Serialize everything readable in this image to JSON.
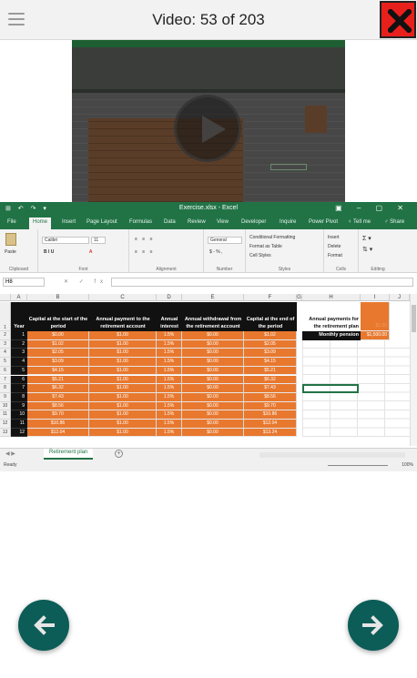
{
  "header": {
    "title": "Video: 53 of 203",
    "close_icon": "close-x-icon",
    "menu_icon": "hamburger-menu-icon",
    "accent": "#e8201c"
  },
  "video": {
    "play_icon": "play-icon"
  },
  "excel": {
    "window_title": "Exercise.xlsx - Excel",
    "quick_access": "⊞ ↶ ↷ ▾",
    "window_controls": "▣ – ▢ ✕",
    "ribbon_tabs": [
      "File",
      "Home",
      "Insert",
      "Page Layout",
      "Formulas",
      "Data",
      "Review",
      "View",
      "Developer",
      "Inquire",
      "Power Pivot",
      "♀ Tell me",
      "♂ Share"
    ],
    "active_tab": "Home",
    "ribbon": {
      "clipboard_label": "Clipboard",
      "paste_label": "Paste",
      "font_label": "Font",
      "font_name": "Calibri",
      "font_size": "11",
      "alignment_label": "Alignment",
      "number_label": "Number",
      "number_format": "General",
      "number_symbols": "$ - % ,",
      "styles_label": "Styles",
      "conditional_formatting": "Conditional Formatting",
      "format_as_table": "Format as Table",
      "cell_styles": "Cell Styles",
      "cells_label": "Cells",
      "insert": "Insert",
      "delete": "Delete",
      "format": "Format",
      "editing_label": "Editing"
    },
    "name_box": "H8",
    "fx": "fx",
    "columns": [
      "A",
      "B",
      "C",
      "D",
      "E",
      "F",
      "G",
      "H",
      "I",
      "J"
    ],
    "table_headers": {
      "year": "Year",
      "b": "Capital at the start of the period",
      "c": "Annual payment to the retirement account",
      "d": "Annual interest",
      "e": "Annual withdrawal from the retirement account",
      "f": "Capital at the end of the period"
    },
    "rows": [
      [
        "1",
        "$0.00",
        "$1.00",
        "1.5%",
        "$0.00",
        "$1.02"
      ],
      [
        "2",
        "$1.02",
        "$1.00",
        "1.5%",
        "$0.00",
        "$2.05"
      ],
      [
        "3",
        "$2.05",
        "$1.00",
        "1.5%",
        "$0.00",
        "$3.09"
      ],
      [
        "4",
        "$3.09",
        "$1.00",
        "1.5%",
        "$0.00",
        "$4.15"
      ],
      [
        "5",
        "$4.15",
        "$1.00",
        "1.5%",
        "$0.00",
        "$5.21"
      ],
      [
        "6",
        "$5.21",
        "$1.00",
        "1.5%",
        "$0.00",
        "$6.32"
      ],
      [
        "7",
        "$6.32",
        "$1.00",
        "1.5%",
        "$0.00",
        "$7.43"
      ],
      [
        "8",
        "$7.43",
        "$1.00",
        "1.5%",
        "$0.00",
        "$8.56"
      ],
      [
        "9",
        "$8.56",
        "$1.00",
        "1.5%",
        "$0.00",
        "$9.70"
      ],
      [
        "10",
        "$9.70",
        "$1.00",
        "1.5%",
        "$0.00",
        "$10.86"
      ],
      [
        "11",
        "$10.86",
        "$1.00",
        "1.5%",
        "$0.00",
        "$12.04"
      ],
      [
        "12",
        "$12.04",
        "$1.00",
        "1.5%",
        "$0.00",
        "$13.24"
      ]
    ],
    "side_table": {
      "header": "Annual payments for the retirement plan",
      "header_value": "$1.00",
      "pension_label": "Monthly pension",
      "pension_value": "$1,500.00"
    },
    "sheet_tab": "Retirement plan",
    "status": "Ready",
    "zoom": "100%",
    "colors": {
      "excel_green": "#217346",
      "orange": "#e8782e",
      "orange_alt": "#f39a5a",
      "header_black": "#111111"
    }
  },
  "nav": {
    "prev_icon": "arrow-left-icon",
    "next_icon": "arrow-right-icon",
    "color": "#0c5c57"
  }
}
